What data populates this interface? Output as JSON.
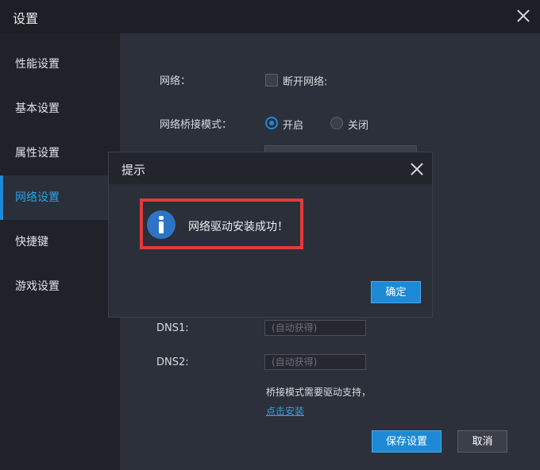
{
  "window": {
    "title": "设置"
  },
  "sidebar": {
    "items": [
      {
        "label": "性能设置",
        "active": false
      },
      {
        "label": "基本设置",
        "active": false
      },
      {
        "label": "属性设置",
        "active": false
      },
      {
        "label": "网络设置",
        "active": true
      },
      {
        "label": "快捷键",
        "active": false
      },
      {
        "label": "游戏设置",
        "active": false
      }
    ]
  },
  "network": {
    "label": "网络：",
    "disconnect_label": "断开网络:",
    "disconnect_checked": false,
    "bridge_label": "网络桥接模式：",
    "bridge_on": "开启",
    "bridge_off": "关闭",
    "bridge_value": "开启",
    "dns1_label": "DNS1:",
    "dns1_value": "(自动获得)",
    "dns2_label": "DNS2:",
    "dns2_value": "(自动获得)",
    "note": "桥接模式需要驱动支持，",
    "install_link": "点击安装"
  },
  "buttons": {
    "save": "保存设置",
    "cancel": "取消"
  },
  "dialog": {
    "title": "提示",
    "message": "网络驱动安装成功！",
    "ok": "确定"
  },
  "colors": {
    "accent": "#1e8ad6",
    "highlight": "#e33a3a",
    "info_icon": "#2d74c7"
  }
}
